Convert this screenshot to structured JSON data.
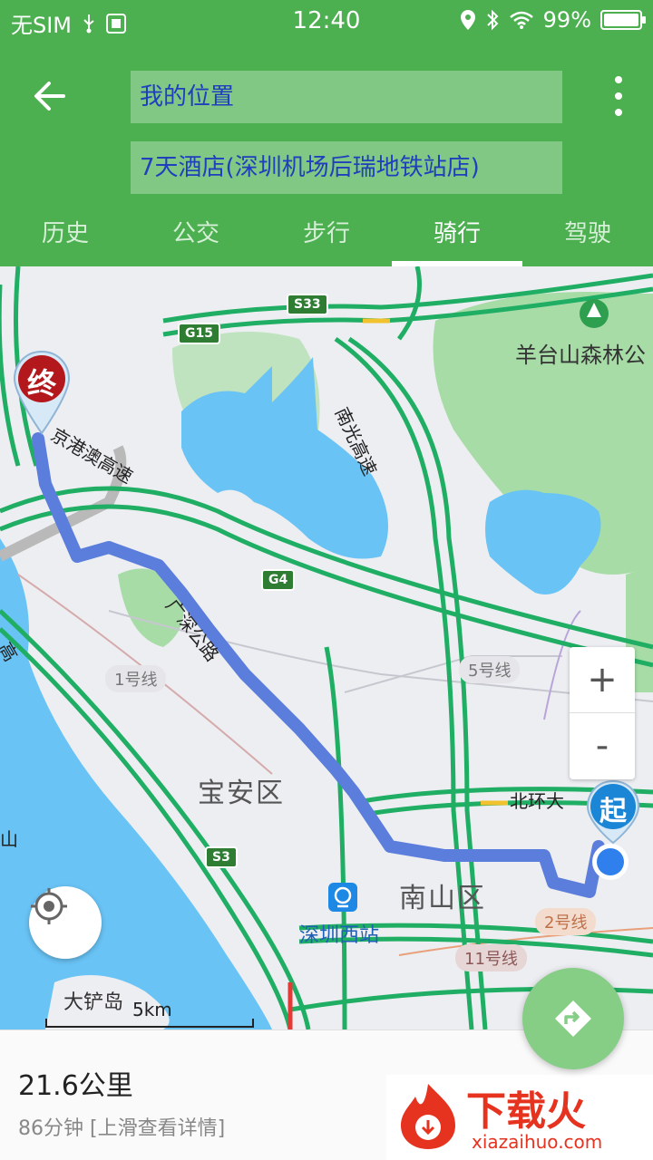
{
  "status_bar": {
    "carrier": "无SIM",
    "time": "12:40",
    "battery": "99%"
  },
  "header": {
    "from_location": "我的位置",
    "to_location": "7天酒店(深圳机场后瑞地铁站店)",
    "tabs": [
      {
        "label": "历史",
        "active": false
      },
      {
        "label": "公交",
        "active": false
      },
      {
        "label": "步行",
        "active": false
      },
      {
        "label": "骑行",
        "active": true
      },
      {
        "label": "驾驶",
        "active": false
      }
    ]
  },
  "map": {
    "park_label": "羊台山森林公",
    "district_baoan": "宝安区",
    "district_nanshan": "南山区",
    "station": "深圳西站",
    "island": "大铲岛",
    "road_jinggangao": "京港澳高速",
    "road_nanguang": "南光高速",
    "road_guangshen": "广深公路",
    "road_beihuan": "北环大",
    "shields": [
      "S33",
      "G15",
      "G4",
      "S3"
    ],
    "metro_lines": [
      "1号线",
      "5号线",
      "2号线",
      "11号线"
    ],
    "end_marker": "终",
    "start_marker": "起",
    "scale_label": "5km",
    "zoom_in": "+",
    "zoom_out": "-",
    "edge_text_left": "山",
    "edge_text_left_top": "高",
    "colors": {
      "route": "#5b7ddb",
      "road": "#1fae63",
      "water": "#69c3f5",
      "park": "#a7dca7"
    }
  },
  "summary": {
    "distance": "21.6公里",
    "duration_hint": "86分钟  [上滑查看详情]"
  },
  "watermark": {
    "brand": "下载火",
    "url": "xiazaihuo.com"
  },
  "icons": [
    "back-arrow-icon",
    "more-vert-icon",
    "locate-icon",
    "navigation-icon",
    "usb-icon",
    "location-pin-icon",
    "bluetooth-icon",
    "wifi-icon",
    "battery-icon",
    "train-station-icon",
    "park-icon"
  ]
}
